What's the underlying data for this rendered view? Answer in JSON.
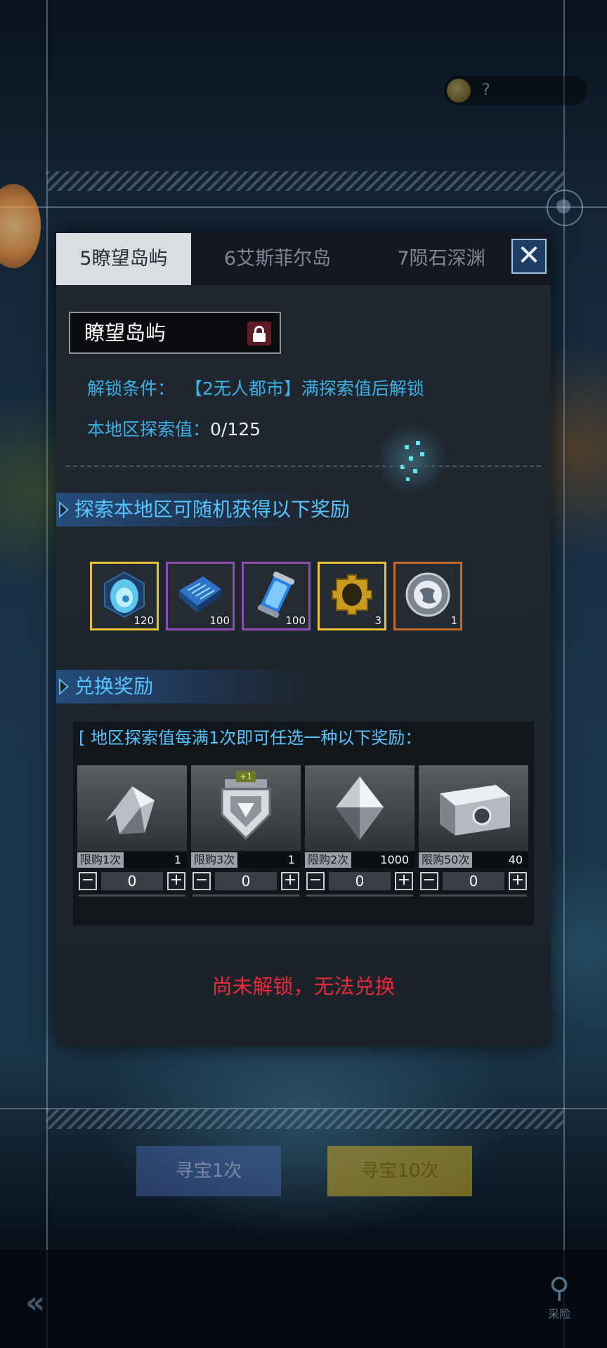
{
  "background": {
    "top_value": "?",
    "button_left": "寻宝1次",
    "button_right": "寻宝10次",
    "map_label": "采险"
  },
  "tabs": [
    {
      "label": "5瞭望岛屿",
      "active": true
    },
    {
      "label": "6艾斯菲尔岛",
      "active": false
    },
    {
      "label": "7陨石深渊",
      "active": false
    }
  ],
  "region": {
    "name": "瞭望岛屿",
    "unlock_label": "解锁条件：",
    "unlock_value": "【2无人都市】满探索值后解锁",
    "explore_label": "本地区探索值：",
    "explore_value": "0/125"
  },
  "random_rewards": {
    "heading": "探索本地区可随机获得以下奖励",
    "items": [
      {
        "icon": "blue-crystal-egg-icon",
        "qty": "120",
        "rarity": "gold"
      },
      {
        "icon": "circuit-chip-icon",
        "qty": "100",
        "rarity": "purple"
      },
      {
        "icon": "energy-canister-icon",
        "qty": "100",
        "rarity": "purple"
      },
      {
        "icon": "gear-puzzle-icon",
        "qty": "3",
        "rarity": "gold"
      },
      {
        "icon": "globe-medal-icon",
        "qty": "1",
        "rarity": "orange"
      }
    ]
  },
  "exchange": {
    "heading": "兑换奖励",
    "subtitle": "[ 地区探索值每满1次即可任选一种以下奖励：",
    "items": [
      {
        "icon": "shard-crystal-icon",
        "limit": "限购1次",
        "cost": "1",
        "count": "0",
        "badge": ""
      },
      {
        "icon": "shield-emblem-icon",
        "limit": "限购3次",
        "cost": "1",
        "count": "0",
        "badge": "+1"
      },
      {
        "icon": "diamond-crystal-icon",
        "limit": "限购2次",
        "cost": "1000",
        "count": "0",
        "badge": ""
      },
      {
        "icon": "supply-chest-icon",
        "limit": "限购50次",
        "cost": "40",
        "count": "0",
        "badge": ""
      }
    ],
    "minus_symbol": "−",
    "plus_symbol": "+"
  },
  "status_message": "尚未解锁，无法兑换",
  "close_symbol": "✕",
  "colors": {
    "accent_blue": "#56c4ff",
    "locked_red": "#e8293a",
    "gold_border": "#e8c234",
    "purple_border": "#8a4fb0",
    "orange_border": "#c46a2a"
  }
}
